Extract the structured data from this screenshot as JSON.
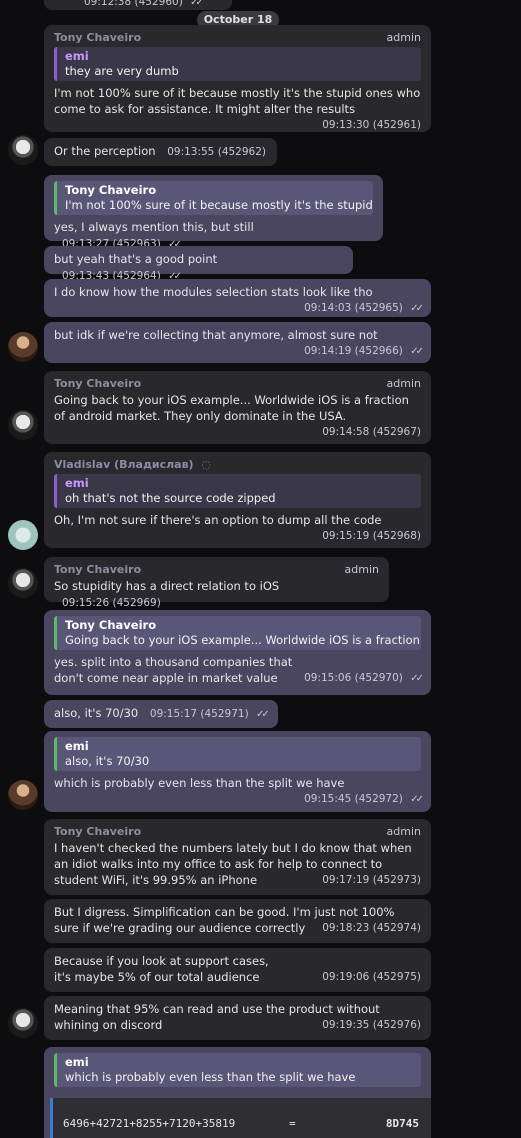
{
  "date_separator": "October 18",
  "top_partial": {
    "time": "09:12:38",
    "id": "(452960)"
  },
  "messages": [
    {
      "sender": "Tony Chaveiro",
      "role": "admin",
      "quote_name": "emi",
      "quote_text": "they are very dumb",
      "text": "I'm not 100% sure of it because mostly it's the stupid ones who come to ask for assistance. It might alter the results",
      "time": "09:13:30",
      "id": "(452961)"
    },
    {
      "text": "Or the perception",
      "time": "09:13:55",
      "id": "(452962)"
    },
    {
      "quote_name": "Tony Chaveiro",
      "quote_text": "I'm not 100% sure of it because mostly it's the stupid ...",
      "text": "yes, I always mention this, but still",
      "time": "09:13:27",
      "id": "(452963)"
    },
    {
      "text": "but yeah that's a good point",
      "time": "09:13:43",
      "id": "(452964)"
    },
    {
      "text": "I do know how the modules selection stats look like tho",
      "time": "09:14:03",
      "id": "(452965)"
    },
    {
      "text": "but idk if we're collecting that anymore, almost sure not",
      "time": "09:14:19",
      "id": "(452966)"
    },
    {
      "sender": "Tony Chaveiro",
      "role": "admin",
      "text": "Going back to your iOS example... Worldwide iOS is a fraction of android market. They only dominate in the USA.",
      "time": "09:14:58",
      "id": "(452967)"
    },
    {
      "sender": "Vladislav (Владислав)",
      "quote_name": "emi",
      "quote_text": "oh that's not the source code zipped",
      "text": "Oh, I'm not sure if there's an option to dump all the code",
      "time": "09:15:19",
      "id": "(452968)"
    },
    {
      "sender": "Tony Chaveiro",
      "role": "admin",
      "text": "So stupidity has a direct relation to iOS",
      "time": "09:15:26",
      "id": "(452969)"
    },
    {
      "quote_name": "Tony Chaveiro",
      "quote_text": "Going back to your iOS example... Worldwide iOS is a fraction o...",
      "text": "yes. split into a thousand companies that don't come near apple in market value",
      "time": "09:15:06",
      "id": "(452970)"
    },
    {
      "text": "also, it's 70/30",
      "time": "09:15:17",
      "id": "(452971)"
    },
    {
      "quote_name": "emi",
      "quote_text": "also, it's 70/30",
      "text": "which is probably even less than the split we have",
      "time": "09:15:45",
      "id": "(452972)"
    },
    {
      "sender": "Tony Chaveiro",
      "role": "admin",
      "text": "I haven't checked the numbers lately but I do know that when an idiot walks into my office to ask for help to connect to student WiFi, it's 99.95% an iPhone",
      "time": "09:17:19",
      "id": "(452973)"
    },
    {
      "text": "But I digress. Simplification can be good. I'm just not 100% sure if we're grading our audience correctly",
      "time": "09:18:23",
      "id": "(452974)"
    },
    {
      "text": "Because if you look at support cases, it's maybe 5% of our total audience",
      "time": "09:19:06",
      "id": "(452975)"
    },
    {
      "text": "Meaning that 95% can read and use the product without whining on discord",
      "time": "09:19:35",
      "id": "(452976)"
    },
    {
      "quote_name": "emi",
      "quote_text": "which is probably even less than the split we have",
      "code_left": "6496+42721+8255+7120+35819",
      "code_eq": "=",
      "code_result": "8D745"
    }
  ]
}
